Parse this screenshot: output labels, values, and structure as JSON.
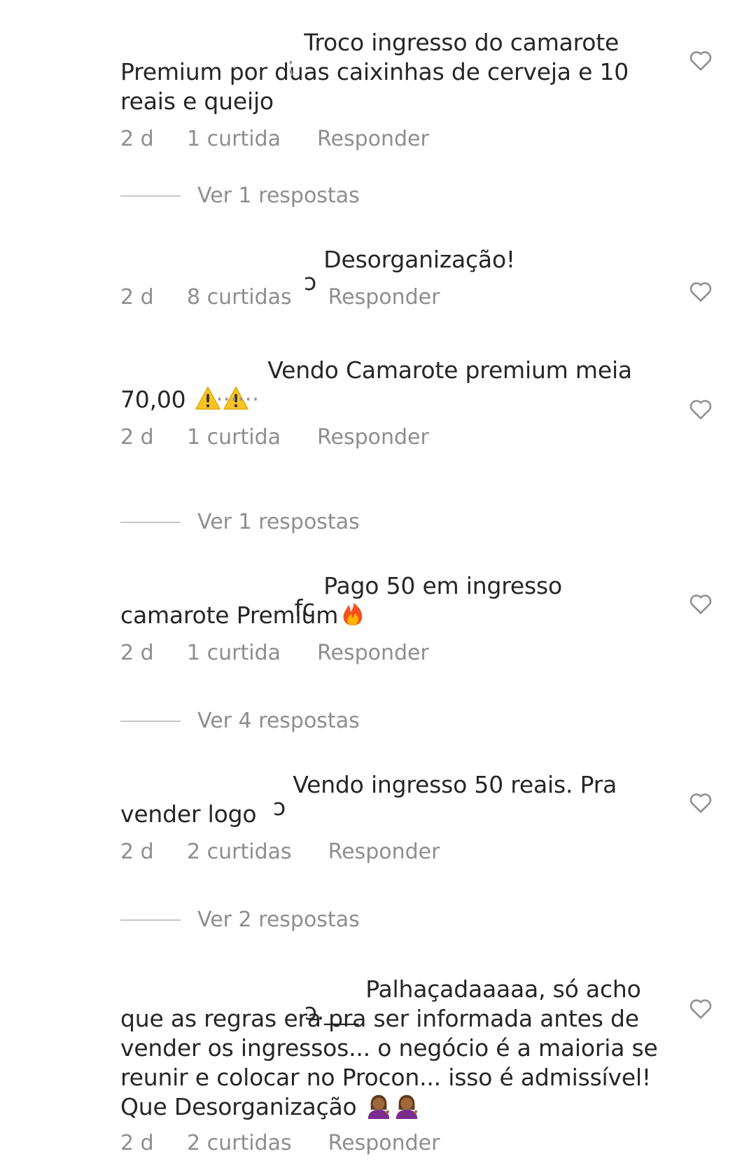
{
  "comments": [
    {
      "username_remnant": "⁏",
      "text": "Troco ingresso do camarote Premium por duas caixinhas de cerveja e 10 reais e queijo",
      "time": "2 d",
      "likes": "1 curtida",
      "reply": "Responder",
      "view_replies": "Ver 1 respostas"
    },
    {
      "username_remnant": "ↄ",
      "text": "Desorganização!",
      "time": "2 d",
      "likes": "8 curtidas",
      "reply": "Responder"
    },
    {
      "username_remnant": "......",
      "text": "Vendo Camarote premium meia 70,00",
      "emoji": [
        "warning-emoji",
        "warning-emoji"
      ],
      "time": "2 d",
      "likes": "1 curtida",
      "reply": "Responder",
      "view_replies": "Ver 1 respostas"
    },
    {
      "username_remnant": "fc",
      "text": "Pago 50 em ingresso camarote Premium",
      "emoji": [
        "fire-emoji"
      ],
      "time": "2 d",
      "likes": "1 curtida",
      "reply": "Responder",
      "view_replies": "Ver 4 respostas"
    },
    {
      "username_remnant": "ɔ",
      "text": "Vendo ingresso 50 reais. Pra vender logo",
      "time": "2 d",
      "likes": "2 curtidas",
      "reply": "Responder",
      "view_replies": "Ver 2 respostas"
    },
    {
      "username_remnant": "ɔ.___",
      "text": "Palhaçadaaaaa, só acho que as regras era pra ser informada antes de vender os ingressos... o negócio é a maioria se reunir e colocar no Procon... isso é admissível! Que Desorganização",
      "emoji": [
        "woman-tipping-hand-emoji",
        "woman-tipping-hand-emoji"
      ],
      "time": "2 d",
      "likes": "2 curtidas",
      "reply": "Responder"
    }
  ],
  "icons": {
    "like": "heart-outline-icon"
  },
  "colors": {
    "text": "#262626",
    "meta": "#8e8e8e",
    "divider": "#c7c7c7"
  }
}
